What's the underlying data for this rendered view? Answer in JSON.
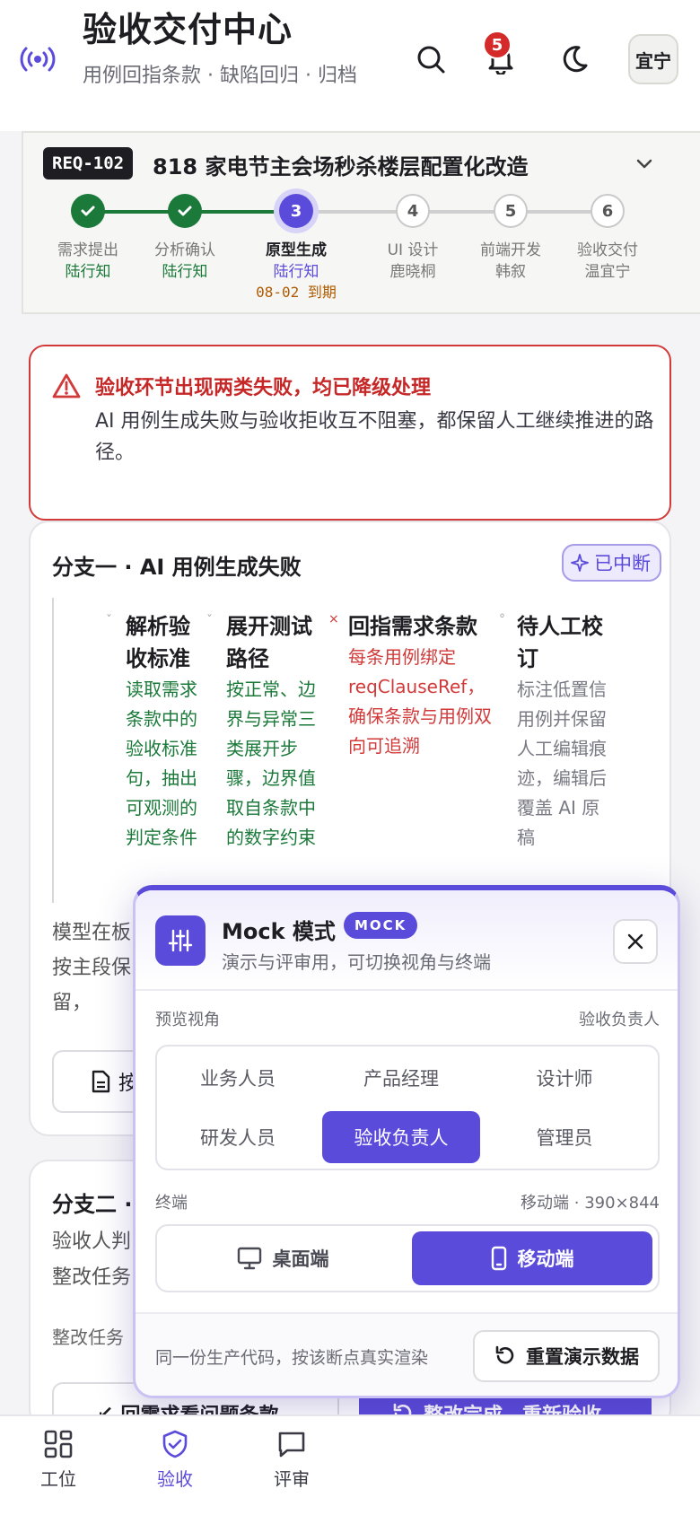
{
  "header": {
    "title": "验收交付中心",
    "subtitle": "用例回指条款 · 缺陷回归 · 归档",
    "notification_count": "5",
    "avatar_text": "宜宁"
  },
  "requirement": {
    "id": "REQ-102",
    "title": "818 家电节主会场秒杀楼层配置化改造",
    "steps": [
      {
        "number": "1",
        "name": "需求提出",
        "owner": "陆行知",
        "state": "done"
      },
      {
        "number": "2",
        "name": "分析确认",
        "owner": "陆行知",
        "state": "done"
      },
      {
        "number": "3",
        "name": "原型生成",
        "owner": "陆行知",
        "state": "current",
        "due": "08-02 到期"
      },
      {
        "number": "4",
        "name": "UI 设计",
        "owner": "鹿晓桐",
        "state": "todo"
      },
      {
        "number": "5",
        "name": "前端开发",
        "owner": "韩叙",
        "state": "todo"
      },
      {
        "number": "6",
        "name": "验收交付",
        "owner": "温宜宁",
        "state": "todo"
      }
    ]
  },
  "alert": {
    "title": "验收环节出现两类失败，均已降级处理",
    "description": "AI 用例生成失败与验收拒收互不阻塞，都保留人工继续推进的路径。"
  },
  "branch_one": {
    "title": "分支一 · AI 用例生成失败",
    "status": "已中断",
    "flow": [
      {
        "title": "解析验收标准",
        "text": "读取需求条款中的验收标准句，抽出可观测的判定条件",
        "state": "ok"
      },
      {
        "title": "展开测试路径",
        "text": "按正常、边界与异常三类展开步骤，边界值取自条款中的数字约束",
        "state": "ok"
      },
      {
        "title": "回指需求条款",
        "text": "每条用例绑定 reqClauseRef，确保条款与用例双向可追溯",
        "state": "fail"
      },
      {
        "title": "待人工校订",
        "text": "标注低置信用例并保留人工编辑痕迹，编辑后覆盖 AI 原稿",
        "state": "pending"
      }
    ],
    "note": "模型在板：按主段保留，",
    "button_partial": "按"
  },
  "branch_two": {
    "title": "分支二 ·",
    "description": "验收人判整改任务",
    "task_label": "整改任务",
    "btn_back": "回需求看问题条款",
    "btn_recheck": "整改完成，重新验收"
  },
  "mock": {
    "title": "Mock 模式",
    "badge": "MOCK",
    "subtitle": "演示与评审用，可切换视角与终端",
    "view_label": "预览视角",
    "view_value": "验收负责人",
    "roles": [
      "业务人员",
      "产品经理",
      "设计师",
      "研发人员",
      "验收负责人",
      "管理员"
    ],
    "active_role": "验收负责人",
    "terminal_label": "终端",
    "terminal_value": "移动端 · 390×844",
    "terminals": [
      "桌面端",
      "移动端"
    ],
    "active_terminal": "移动端",
    "footer_note": "同一份生产代码，按该断点真实渲染",
    "reset_label": "重置演示数据"
  },
  "bottom_nav": [
    {
      "label": "工位",
      "icon": "grid-icon"
    },
    {
      "label": "验收",
      "icon": "shield-check-icon",
      "active": true
    },
    {
      "label": "评审",
      "icon": "chat-icon"
    }
  ],
  "colors": {
    "accent": "#5b4bdb",
    "success": "#1b7a3a",
    "danger": "#d23a3a",
    "warning": "#b05a00"
  }
}
